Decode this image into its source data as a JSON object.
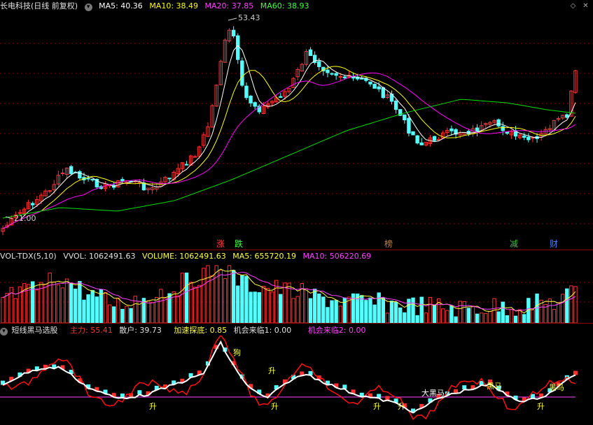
{
  "main_header": {
    "stock_title": "长电科技(日线 前复权)",
    "ma5": "MA5: 40.36",
    "ma10": "MA10: 38.49",
    "ma20": "MA20: 37.85",
    "ma60": "MA60: 38.93"
  },
  "price_annotations": {
    "high": "53.43",
    "low": "21.00"
  },
  "event_tags": [
    {
      "label": "涨",
      "color": "#ff4040"
    },
    {
      "label": "跌",
      "color": "#40ff40"
    },
    {
      "label": "榜",
      "color": "#c08040"
    },
    {
      "label": "减",
      "color": "#40c040"
    },
    {
      "label": "财",
      "color": "#4080ff"
    }
  ],
  "volume_header": {
    "name": "VOL-TDX(5,10)",
    "vvol": "VVOL: 1062491.63",
    "volume": "VOLUME: 1062491.63",
    "ma5": "MA5: 655720.19",
    "ma10": "MA10: 506220.69"
  },
  "indicator_header": {
    "name": "短线黑马选股",
    "main_force": "主力: 55.41",
    "retail": "散户: 39.73",
    "accel": "加速探底: 0.85",
    "chance1": "机会来临1: 0.00",
    "chance2": "机会来临2: 0.00"
  },
  "indicator_labels": {
    "gou": "狗",
    "sheng": "升",
    "tai_heima": "大黑马",
    "heima": "黑马"
  },
  "colors": {
    "up": "#ff3232",
    "down": "#54ffff",
    "ma5": "#ffffff",
    "ma10": "#ffff00",
    "ma20": "#ff00ff",
    "ma60": "#00e000",
    "grid": "#8b0000"
  },
  "icons": {
    "settings": "gear-icon",
    "collapse": "diamond-icon",
    "close": "close-icon"
  }
}
